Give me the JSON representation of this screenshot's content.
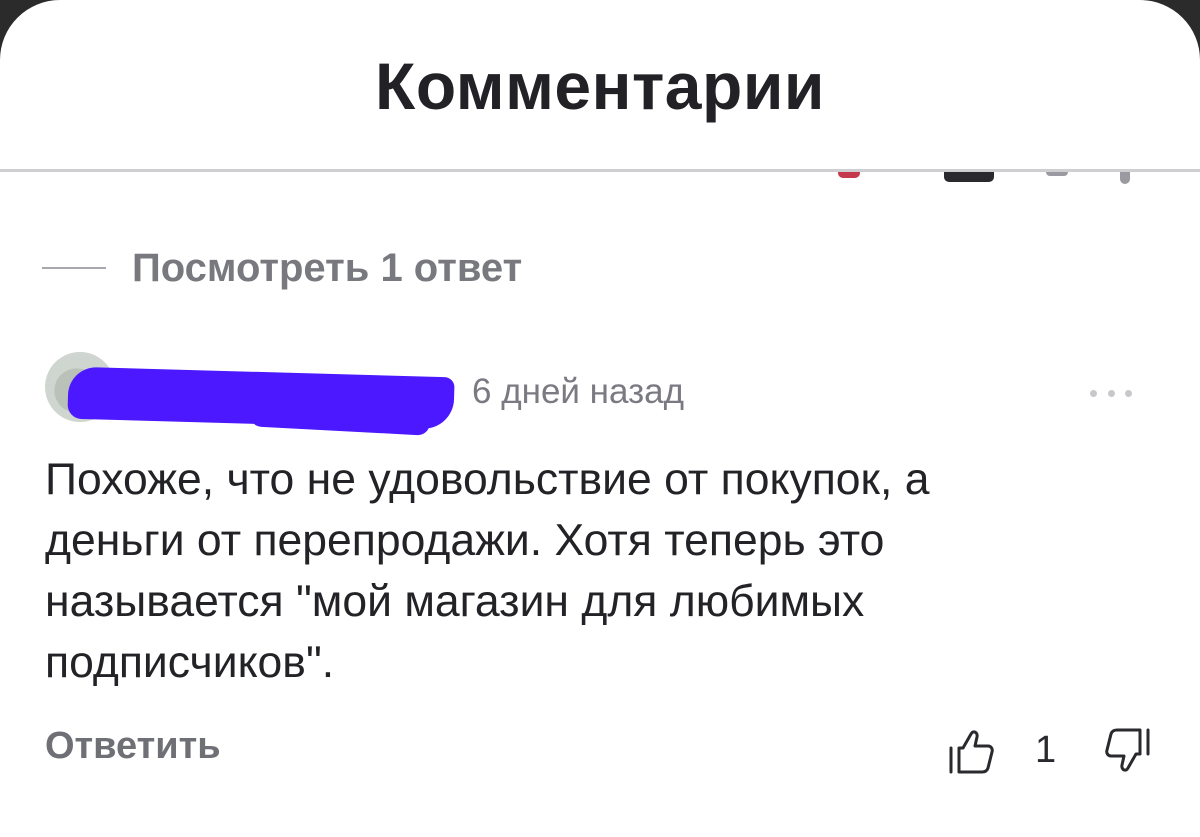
{
  "header": {
    "title": "Комментарии"
  },
  "replies_link": {
    "label": "Посмотреть 1 ответ"
  },
  "comment": {
    "timestamp": "6 дней назад",
    "text": "Похоже, что не удовольствие от покупок, а\nденьги от перепродажи. Хотя теперь это\nназывается \"мой магазин для любимых\nподписчиков\".",
    "reply_label": "Ответить",
    "like_count": "1",
    "like_icon": "thumbs-up-icon",
    "dislike_icon": "thumbs-down-icon",
    "more_icon": "more-horizontal-icon"
  },
  "colors": {
    "redaction": "#4b18ff",
    "text": "#232327",
    "muted": "#78787f"
  }
}
